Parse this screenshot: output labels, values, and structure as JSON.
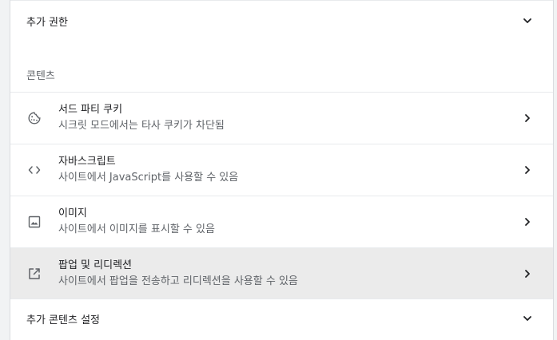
{
  "more_permissions": {
    "label": "추가 권한"
  },
  "content_section": {
    "title": "콘텐츠"
  },
  "items": [
    {
      "title": "서드 파티 쿠키",
      "subtitle": "시크릿 모드에서는 타사 쿠키가 차단됨",
      "icon": "cookie-icon"
    },
    {
      "title": "자바스크립트",
      "subtitle": "사이트에서 JavaScript를 사용할 수 있음",
      "icon": "code-icon"
    },
    {
      "title": "이미지",
      "subtitle": "사이트에서 이미지를 표시할 수 있음",
      "icon": "image-icon"
    },
    {
      "title": "팝업 및 리디렉션",
      "subtitle": "사이트에서 팝업을 전송하고 리디렉션을 사용할 수 있음",
      "icon": "open-in-new-icon"
    }
  ],
  "more_content_settings": {
    "label": "추가 콘텐츠 설정"
  },
  "colors": {
    "background": "#f1f3f4",
    "card": "#ffffff",
    "hover_row": "#ebebeb",
    "divider": "#e8eaed",
    "secondary_text": "#5f6368"
  }
}
